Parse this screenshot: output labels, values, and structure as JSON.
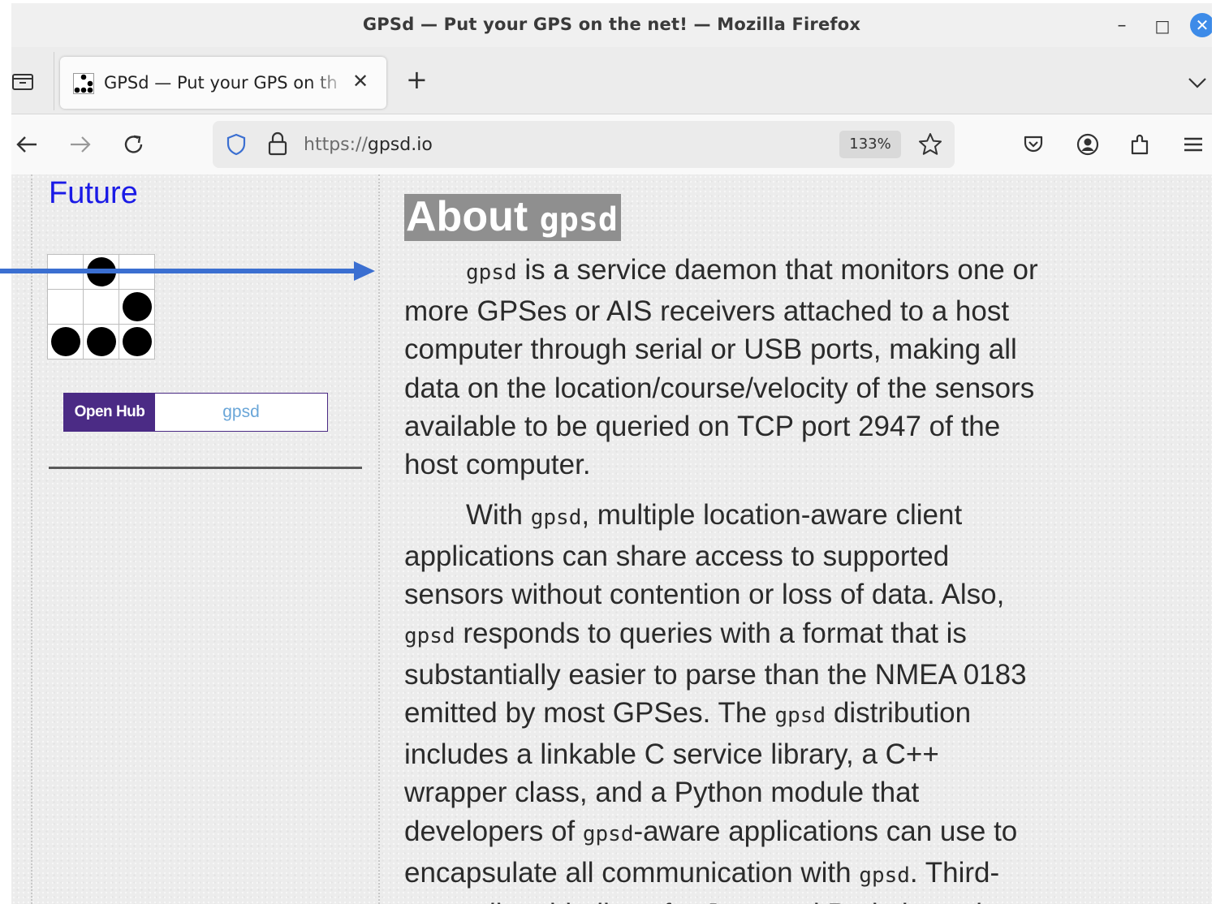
{
  "window": {
    "title": "GPSd — Put your GPS on the net! — Mozilla Firefox",
    "controls": {
      "minimize": "–",
      "maximize": "□",
      "close": "✕"
    }
  },
  "tabs": {
    "active_title": "GPSd — Put your GPS on the net! — Mozilla Firefox",
    "active_title_shown": "GPSd — Put your GPS on th",
    "close_glyph": "✕",
    "new_tab_glyph": "+"
  },
  "navbar": {
    "url_scheme": "https://",
    "url_host": "gpsd.io",
    "zoom": "133%"
  },
  "sidebar": {
    "future_link": "Future",
    "glider_cells": [
      [
        false,
        true,
        false
      ],
      [
        false,
        false,
        true
      ],
      [
        true,
        true,
        true
      ]
    ],
    "openhub_label": "Open Hub",
    "openhub_project": "gpsd"
  },
  "main": {
    "heading_word": "About",
    "heading_code": "gpsd",
    "para1_lines": [
      [
        "gpsd",
        " is a service daemon that monitors one or"
      ],
      [
        "",
        "more GPSes or AIS receivers attached to a host"
      ],
      [
        "",
        "computer through serial or USB ports, making all"
      ],
      [
        "",
        "data on the location/course/velocity of the sensors"
      ],
      [
        "",
        "available to be queried on TCP port 2947 of the"
      ],
      [
        "",
        "host computer."
      ]
    ],
    "para2_html_lines": [
      "With <span class=\"code\">gpsd</span>, multiple location-aware client",
      "applications can share access to supported",
      "sensors without contention or loss of data. Also,",
      "<span class=\"code\">gpsd</span> responds to queries with a format that is",
      "substantially easier to parse than the NMEA 0183",
      "emitted by most GPSes. The <span class=\"code\">gpsd</span> distribution",
      "includes a linkable C service library, a C++",
      "wrapper class, and a Python module that",
      "developers of <span class=\"code\">gpsd</span>-aware applications can use to",
      "encapsulate all communication with <span class=\"code\">gpsd</span>. Third-",
      "party client bindings for Java and Perl also exist."
    ]
  },
  "colors": {
    "annotation_arrow": "#3b6fd1",
    "openhub_purple": "#4b2b85",
    "link_blue": "#1a1ae6",
    "heading_bg": "#8f8f8f"
  },
  "icons": [
    "tab-list-icon",
    "gpsd-favicon",
    "back-arrow-icon",
    "forward-arrow-icon",
    "reload-icon",
    "shield-icon",
    "lock-icon",
    "star-icon",
    "pocket-icon",
    "account-icon",
    "extensions-icon",
    "menu-icon",
    "chevron-down-icon"
  ]
}
